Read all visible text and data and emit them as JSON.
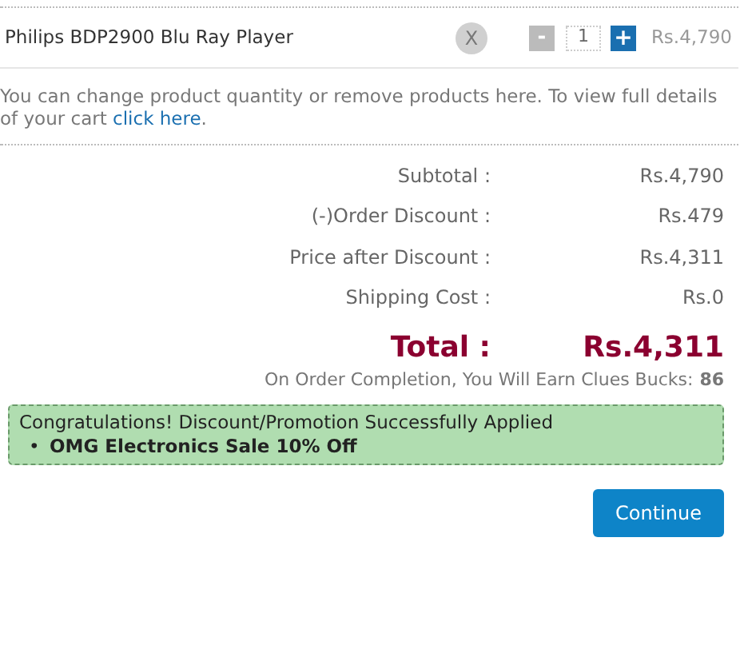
{
  "cart_item": {
    "name": "Philips BDP2900 Blu Ray Player",
    "remove": "X",
    "decrease": "-",
    "quantity": "1",
    "increase": "+",
    "price": "Rs.4,790"
  },
  "note": {
    "text": "You can change product quantity or remove products here. To view full details of your cart",
    "link": "click here",
    "end": "."
  },
  "summary": [
    {
      "label": "Subtotal :",
      "value": "Rs.4,790"
    },
    {
      "label": "(-)Order Discount :",
      "value": "Rs.479"
    },
    {
      "label": "Price after Discount :",
      "value": "Rs.4,311"
    },
    {
      "label": "Shipping Cost :",
      "value": "Rs.0"
    }
  ],
  "total": {
    "label": "Total :",
    "value": "Rs.4,311"
  },
  "bucks": {
    "text": "On Order Completion, You Will Earn Clues Bucks:",
    "value": "86"
  },
  "promo": {
    "title": "Congratulations! Discount/Promotion Successfully Applied",
    "items": [
      {
        "bullet": "•",
        "text": "OMG Electronics Sale 10% Off"
      }
    ]
  },
  "continue_button": "Continue"
}
